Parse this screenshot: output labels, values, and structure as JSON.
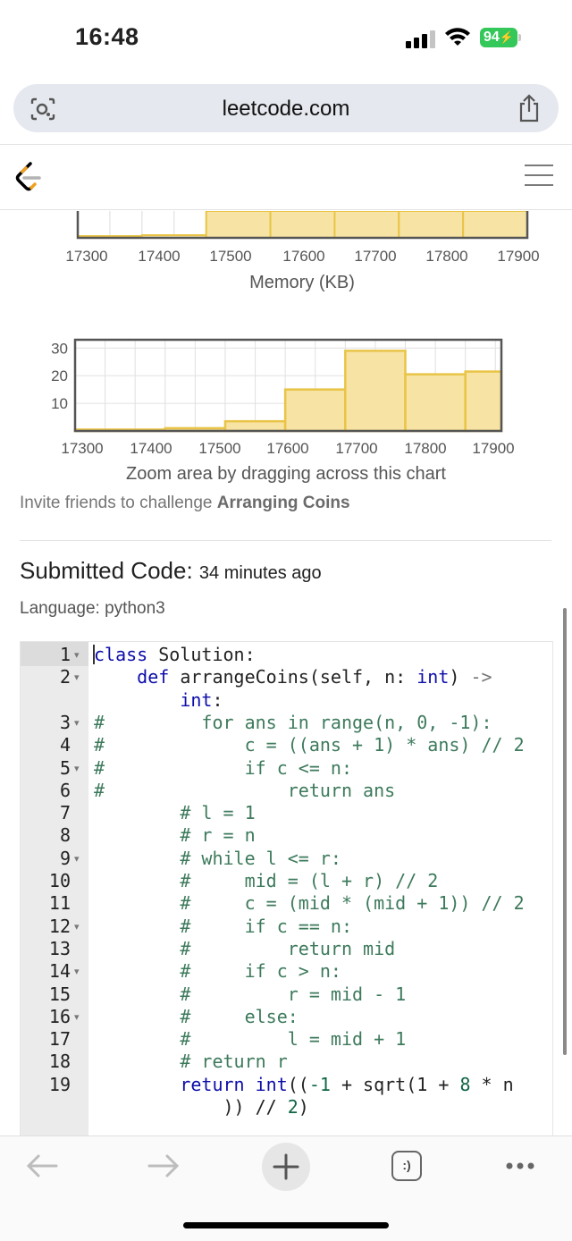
{
  "status_bar": {
    "time": "16:48",
    "battery": "94"
  },
  "browser": {
    "url": "leetcode.com"
  },
  "memory_chart": {
    "xlabel": "Memory (KB)"
  },
  "second_chart": {
    "hint": "Zoom area by dragging across this chart"
  },
  "chart_data": [
    {
      "type": "bar",
      "title": "",
      "xlabel": "Memory (KB)",
      "ylabel": "",
      "x_ticks": [
        "17300",
        "17400",
        "17500",
        "17600",
        "17700",
        "17800",
        "17900"
      ],
      "bins": [
        [
          17250,
          17350
        ],
        [
          17350,
          17450
        ],
        [
          17450,
          17550
        ],
        [
          17550,
          17650
        ],
        [
          17650,
          17750
        ],
        [
          17750,
          17850
        ],
        [
          17850,
          17950
        ]
      ],
      "values": [
        null,
        null,
        null,
        null,
        null,
        null,
        null
      ],
      "note_visible": "cropped view; only bottom of bars visible",
      "grid": true
    },
    {
      "type": "bar",
      "title": "",
      "xlabel": "",
      "ylabel": "",
      "x_ticks": [
        "17300",
        "17400",
        "17500",
        "17600",
        "17700",
        "17800",
        "17900"
      ],
      "y_ticks": [
        "10",
        "20",
        "30"
      ],
      "ylim": [
        0,
        33
      ],
      "bins": [
        [
          17250,
          17400
        ],
        [
          17400,
          17500
        ],
        [
          17500,
          17600
        ],
        [
          17600,
          17700
        ],
        [
          17700,
          17800
        ],
        [
          17800,
          17900
        ],
        [
          17900,
          17960
        ]
      ],
      "values": [
        0.5,
        1,
        3.5,
        15,
        29,
        20.5,
        21.5
      ],
      "grid": true
    }
  ],
  "invite": {
    "prefix": "Invite friends to challenge ",
    "problem": "Arranging Coins"
  },
  "submission": {
    "title": "Submitted Code:",
    "ago": "34 minutes ago",
    "language": "Language: python3"
  },
  "code": {
    "gutter": [
      "1",
      "2",
      "",
      "3",
      "4",
      "5",
      "6",
      "7",
      "8",
      "9",
      "10",
      "11",
      "12",
      "13",
      "14",
      "15",
      "16",
      "17",
      "18",
      "19",
      ""
    ],
    "folds": [
      true,
      true,
      false,
      true,
      false,
      true,
      false,
      false,
      false,
      true,
      false,
      false,
      true,
      false,
      true,
      false,
      true,
      false,
      false,
      false,
      false
    ],
    "lines": [
      "class Solution:",
      "    def arrangeCoins(self, n: int) ->",
      "        int:",
      "#         for ans in range(n, 0, -1):",
      "#             c = ((ans + 1) * ans) // 2",
      "#             if c <= n:",
      "#                 return ans",
      "        # l = 1",
      "        # r = n",
      "        # while l <= r:",
      "        #     mid = (l + r) // 2",
      "        #     c = (mid * (mid + 1)) // 2",
      "        #     if c == n:",
      "        #         return mid",
      "        #     if c > n:",
      "        #         r = mid - 1",
      "        #     else:",
      "        #         l = mid + 1",
      "        # return r",
      "        return int((-1 + sqrt(1 + 8 * n",
      "            )) // 2)"
    ]
  },
  "toolbar": {
    "tabs_label": ":)"
  }
}
